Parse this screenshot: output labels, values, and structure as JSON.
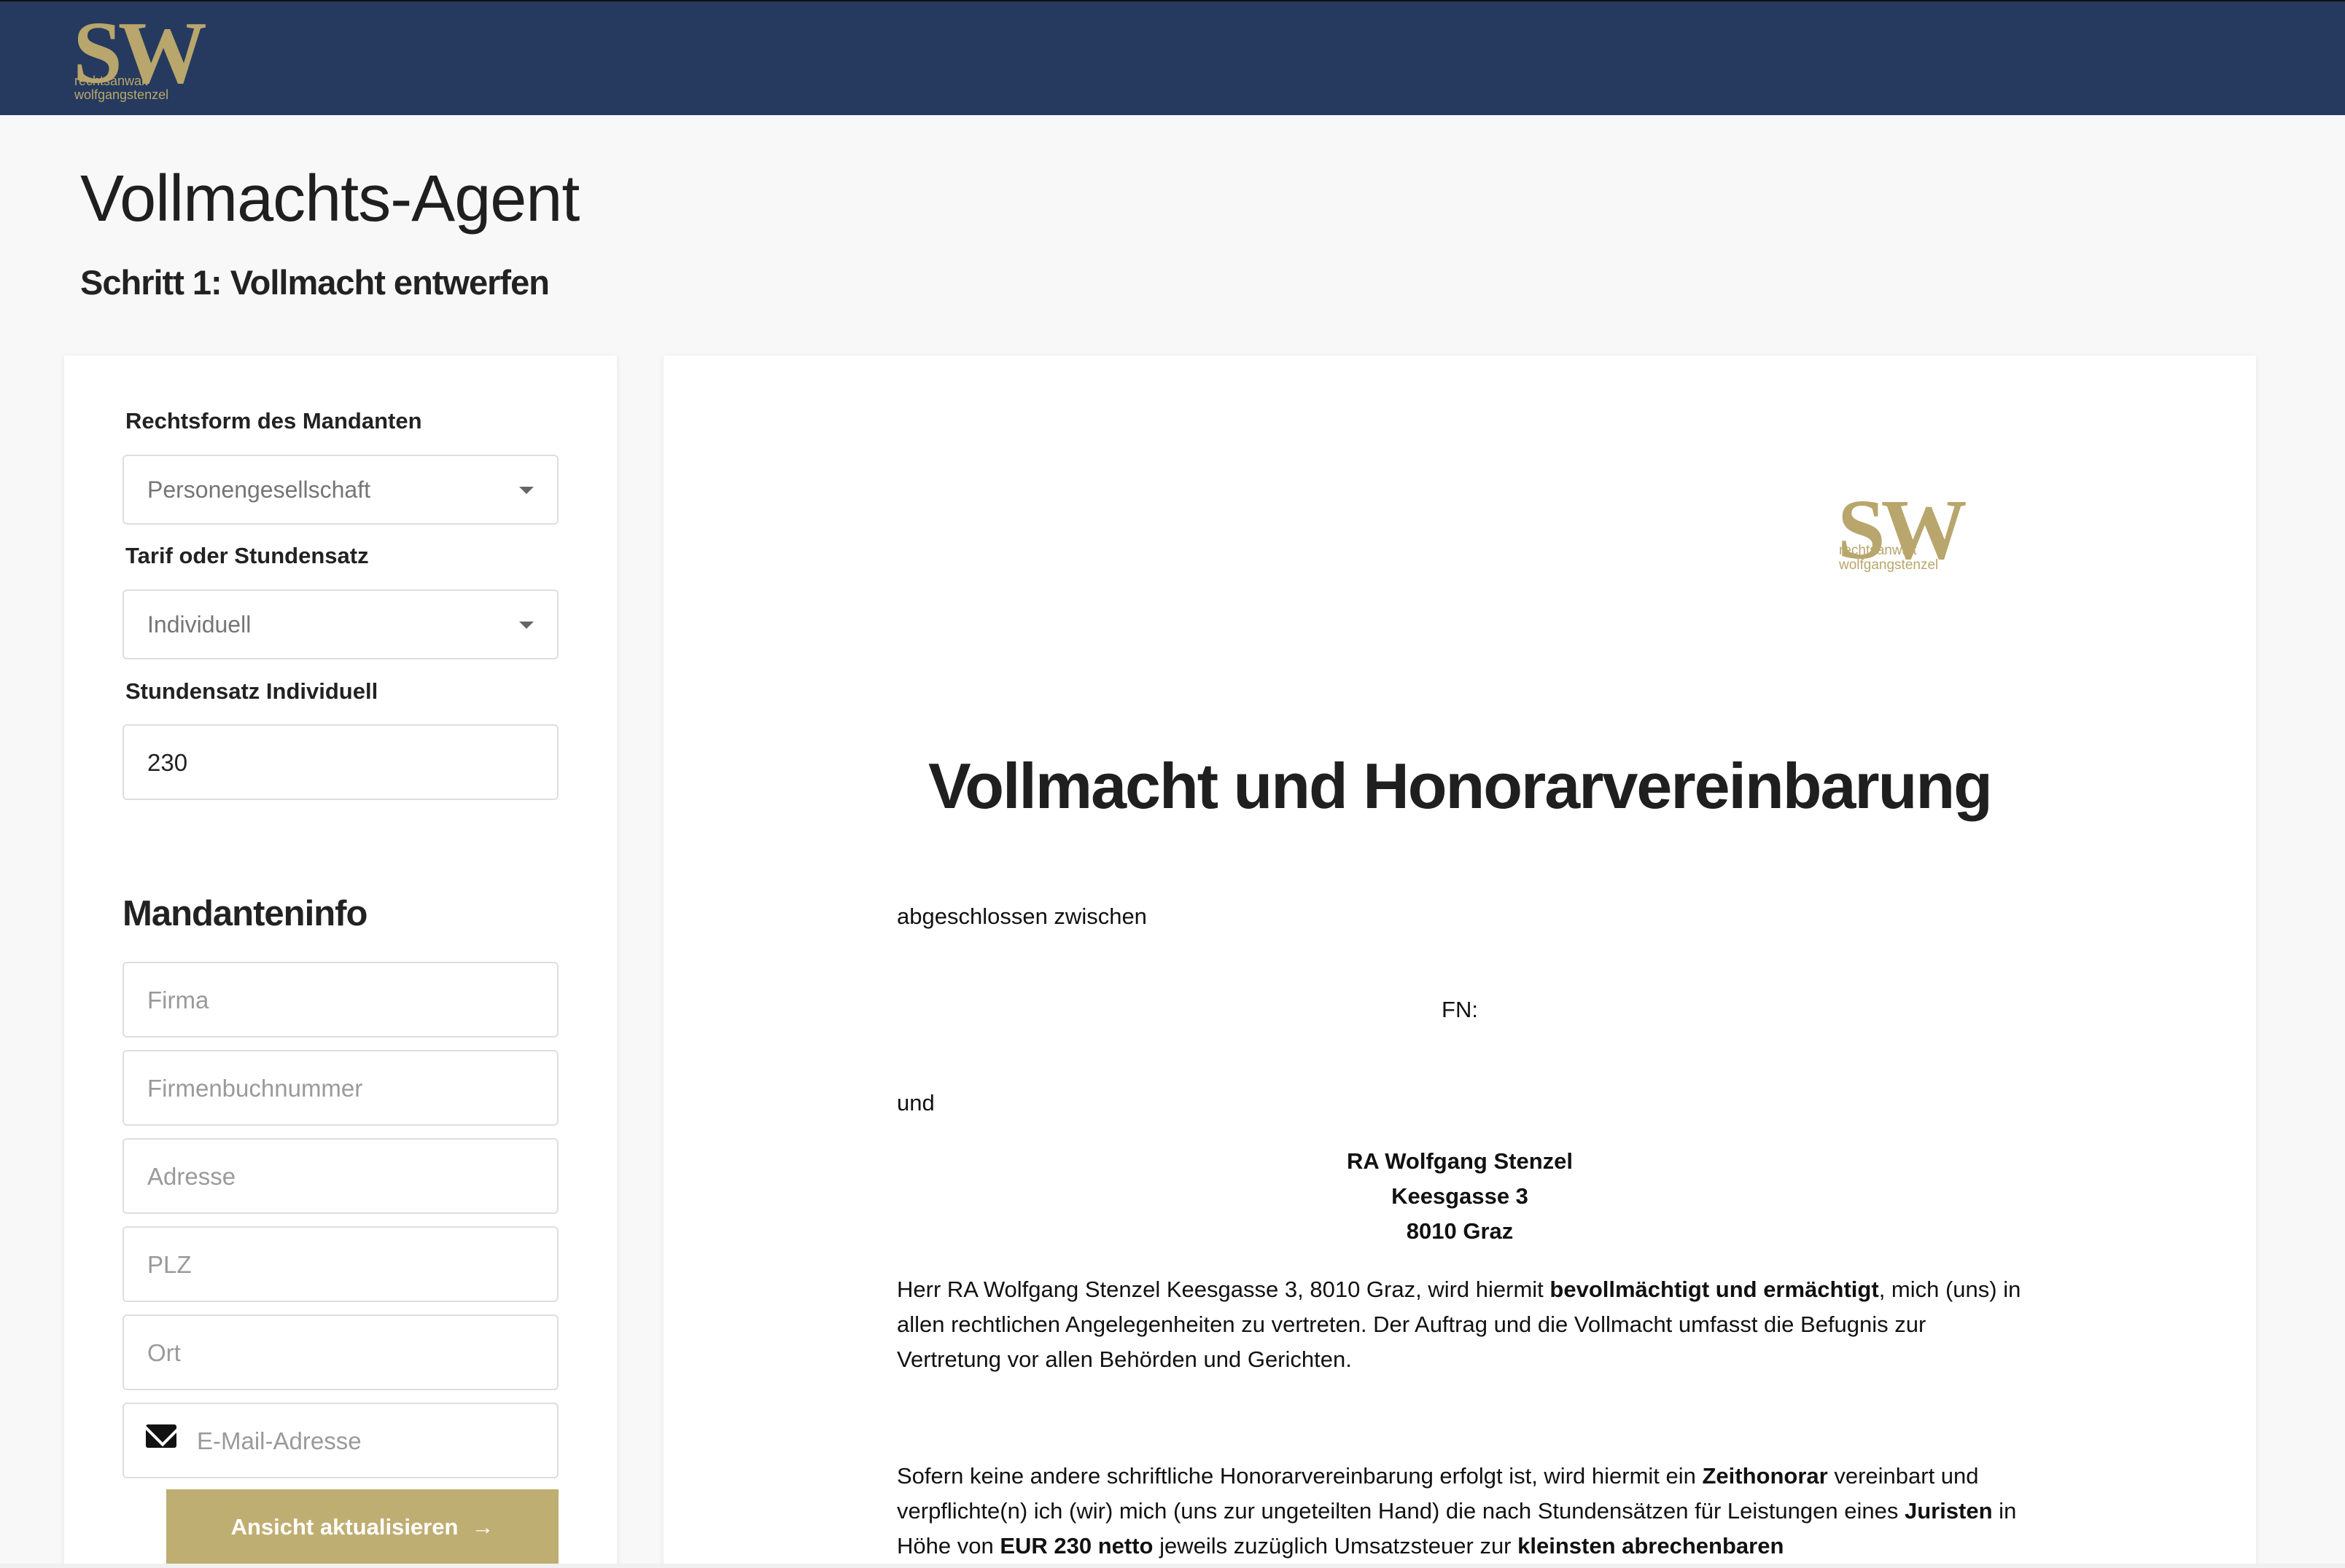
{
  "brand": {
    "letters": "SW",
    "line1": "rechtsanwalt",
    "line2": "wolfgangstenzel",
    "color": "#b8a66c",
    "header_color": "#253a5e"
  },
  "page": {
    "title": "Vollmachts-Agent",
    "subtitle": "Schritt 1: Vollmacht entwerfen"
  },
  "form": {
    "legal_form": {
      "label": "Rechtsform des Mandanten",
      "value": "Personengesellschaft"
    },
    "tariff": {
      "label": "Tarif oder Stundensatz",
      "value": "Individuell"
    },
    "hourly_rate": {
      "label": "Stundensatz Individuell",
      "value": "230"
    },
    "client_info": {
      "title": "Mandanteninfo",
      "company_placeholder": "Firma",
      "register_placeholder": "Firmenbuchnummer",
      "address_placeholder": "Adresse",
      "postcode_placeholder": "PLZ",
      "city_placeholder": "Ort",
      "email_placeholder": "E-Mail-Adresse"
    },
    "update_button": "Ansicht aktualisieren",
    "update_button_arrow": "→",
    "button_color": "#bfae72"
  },
  "document": {
    "title": "Vollmacht und Honorarvereinbarung",
    "between": "abgeschlossen zwischen",
    "fn": "FN:",
    "and": "und",
    "lawyer_name": "RA Wolfgang Stenzel",
    "lawyer_street": "Keesgasse 3",
    "lawyer_city": "8010 Graz",
    "p1_a": "Herr RA Wolfgang Stenzel Keesgasse 3, 8010 Graz, wird hiermit ",
    "p1_b": "bevollmächtigt und ermächtigt",
    "p1_c": ", mich (uns) in allen rechtlichen Angelegenheiten zu vertreten. Der Auftrag und die Vollmacht umfasst die Befugnis zur Vertretung vor allen Behörden und Gerichten.",
    "p2_a": "Sofern keine andere schriftliche Honorarvereinbarung erfolgt ist, wird hiermit ein ",
    "p2_b": "Zeithonorar",
    "p2_c": " vereinbart und verpflichte(n) ich (wir) mich (uns zur ungeteilten Hand) die nach Stundensätzen für Leistungen eines ",
    "p2_d": "Juristen",
    "p2_e": " in Höhe von ",
    "p2_f": "EUR 230 netto",
    "p2_g": " jeweils zuzüglich Umsatzsteuer zur ",
    "p2_h": "kleinsten abrechenbaren"
  }
}
